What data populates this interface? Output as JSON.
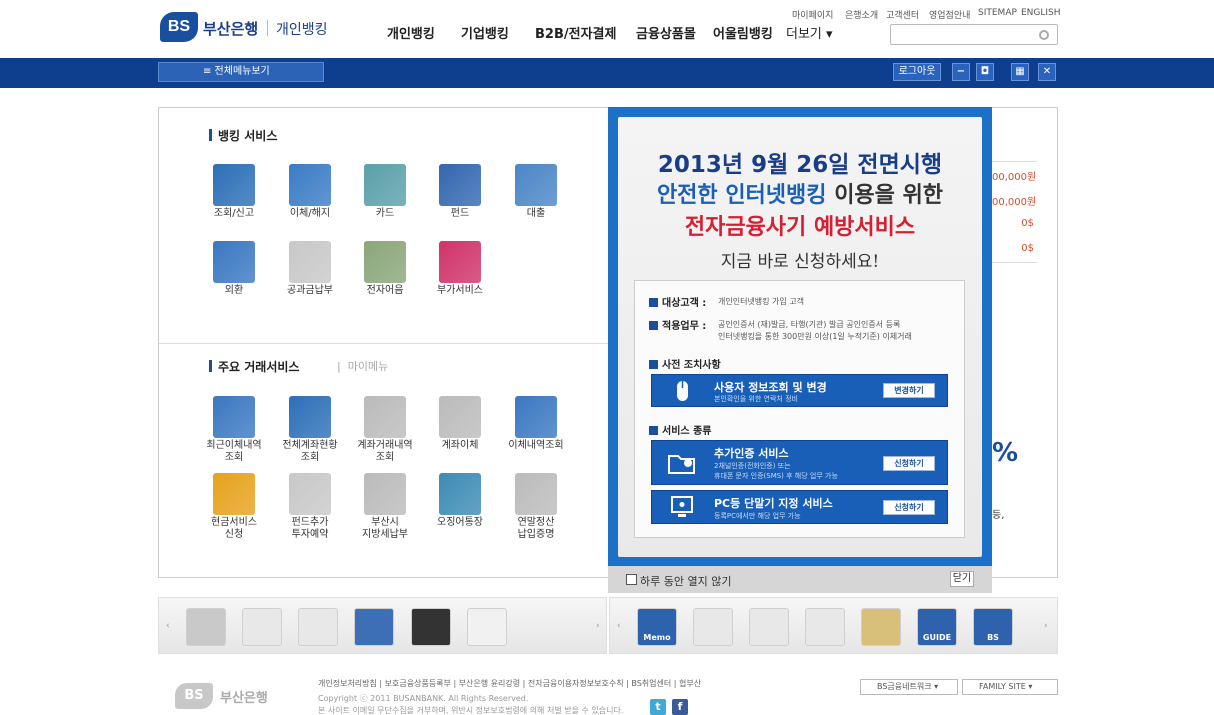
{
  "header": {
    "logo_mark": "BS",
    "logo_text": "부산은행",
    "logo_sub": "개인뱅킹",
    "utility": [
      "마이페이지",
      "은행소개",
      "고객센터",
      "영업점안내",
      "SITEMAP",
      "ENGLISH"
    ],
    "gnb": [
      "개인뱅킹",
      "기업뱅킹",
      "B2B/전자결제",
      "금융상품몰",
      "어울림뱅킹",
      "더보기 ▾"
    ],
    "search_placeholder": ""
  },
  "bar": {
    "all_menu": "≡ 전체메뉴보기",
    "logout": "로그아웃",
    "buttons": [
      "−",
      "◘",
      "▦",
      "✕"
    ]
  },
  "banking": {
    "title": "뱅킹 서비스",
    "items": [
      {
        "label": "조회/신고",
        "icon": "inquiry-icon",
        "color": "#2c6fb7"
      },
      {
        "label": "이체/해지",
        "icon": "transfer-icon",
        "color": "#3a7cc6"
      },
      {
        "label": "카드",
        "icon": "card-icon",
        "color": "#5aa0a8"
      },
      {
        "label": "펀드",
        "icon": "fund-icon",
        "color": "#3367b0"
      },
      {
        "label": "대출",
        "icon": "loan-icon",
        "color": "#4a86c6"
      },
      {
        "label": "외환",
        "icon": "forex-icon",
        "color": "#3a78c2"
      },
      {
        "label": "공과금납부",
        "icon": "bill-icon",
        "color": "#c8c8c8"
      },
      {
        "label": "전자어음",
        "icon": "e-bill-icon",
        "color": "#8aa67a"
      },
      {
        "label": "부가서비스",
        "icon": "extra-icon",
        "color": "#d0336a"
      }
    ]
  },
  "transactions": {
    "title": "주요 거래서비스",
    "sub": "마이메뉴",
    "items": [
      {
        "label": "최근이체내역\n조회",
        "icon": "recent-transfer-icon",
        "color": "#3a78c2"
      },
      {
        "label": "전체계좌현황\n조회",
        "icon": "account-status-icon",
        "color": "#2c6fb7"
      },
      {
        "label": "계좌거래내역\n조회",
        "icon": "account-history-icon",
        "color": "#bbbbbb"
      },
      {
        "label": "계좌이체",
        "icon": "account-transfer-icon",
        "color": "#bbbbbb"
      },
      {
        "label": "이체내역조회",
        "icon": "transfer-history-icon",
        "color": "#3a78c2"
      },
      {
        "label": "현금서비스\n신청",
        "icon": "cash-service-icon",
        "color": "#e6a21c"
      },
      {
        "label": "펀드추가\n투자예약",
        "icon": "fund-reserve-icon",
        "color": "#c8c8c8"
      },
      {
        "label": "부산시\n지방세납부",
        "icon": "local-tax-icon",
        "color": "#bbbbbb"
      },
      {
        "label": "오징어통장",
        "icon": "squid-account-icon",
        "color": "#3d8bb5"
      },
      {
        "label": "연말정산\n납입증명",
        "icon": "tax-cert-icon",
        "color": "#bbbbbb"
      }
    ]
  },
  "right_values": [
    "00,000원",
    "00,000원",
    "0$",
    "0$"
  ],
  "right_partial": [
    "%",
    "등,"
  ],
  "popup": {
    "line1": "2013년 9월 26일 전면시행",
    "line2_a": "안전한 인터넷뱅킹",
    "line2_b": " 이용을 위한",
    "line3": "전자금융사기 예방서비스",
    "line4": "지금 바로 신청하세요!",
    "target_label": "대상고객 :",
    "target_text": "개인인터넷뱅킹 가입 고객",
    "scope_label": "적용업무 :",
    "scope_text1": "공인인증서 (재)발급, 타행(기관) 발급 공인인증서 등록",
    "scope_text2": "인터넷뱅킹을 통한 300만원 이상(1일 누적기준) 이체거래",
    "pre_label": "사전 조치사항",
    "pre_title": "사용자 정보조회 및 변경",
    "pre_sub": "본인확인을 위한 연락처 정비",
    "pre_btn": "변경하기",
    "svc_label": "서비스 종류",
    "auth_title": "추가인증 서비스",
    "auth_sub1": "2채널인증(전화인증) 또는",
    "auth_sub2": "휴대폰 문자 인증(SMS) 후 해당 업무 가능",
    "auth_btn": "신청하기",
    "pc_title": "PC등 단말기 지정 서비스",
    "pc_sub": "등록PC에서만 해당 업무 가능",
    "pc_btn": "신청하기",
    "no_open_today": "하루 동안 열지 않기",
    "close": "닫기"
  },
  "bottom_left_icons": [
    {
      "icon": "magnifier-icon",
      "color": "#c9c9c9"
    },
    {
      "icon": "route-icon",
      "color": "#e8e8e8"
    },
    {
      "icon": "exchange-up-icon",
      "color": "#e8e8e8"
    },
    {
      "icon": "puzzle-icon",
      "color": "#3c6fb5"
    },
    {
      "icon": "bs-tablet-icon",
      "color": "#333333"
    },
    {
      "icon": "alarm-icon",
      "color": "#f1f1f1"
    }
  ],
  "bottom_right_icons": [
    {
      "icon": "memo-icon",
      "color": "#2e62ad",
      "label": "Memo"
    },
    {
      "icon": "calendar-icon",
      "color": "#e8e8e8",
      "label": ""
    },
    {
      "icon": "otp-icon",
      "color": "#e8e8e8",
      "label": ""
    },
    {
      "icon": "lock-icon",
      "color": "#e8e8e8",
      "label": ""
    },
    {
      "icon": "map-icon",
      "color": "#d9c07a",
      "label": ""
    },
    {
      "icon": "guide-icon",
      "color": "#2e62ad",
      "label": "GUIDE"
    },
    {
      "icon": "bs-book-icon",
      "color": "#2e62ad",
      "label": "BS"
    }
  ],
  "footer": {
    "logo_mark": "BS",
    "logo_text": "부산은행",
    "links": "개인정보처리방침  |  보호금융상품등록부  |  부산은행 윤리강령  |  전자금융이용자정보보호수칙  |  BS취업센터  |  협부산",
    "copyright": "Copyright ⓒ 2011 BUSANBANK. All Rights Reserved.",
    "copyright2": "본 사이트 이메일 무단수집을 거부하며, 위반시 정보보호법령에 의해 처벌 받을 수 있습니다.",
    "select1": "BS금융네트워크  ▾",
    "select2": "FAMILY SITE  ▾",
    "sns": [
      "t",
      "f"
    ]
  }
}
